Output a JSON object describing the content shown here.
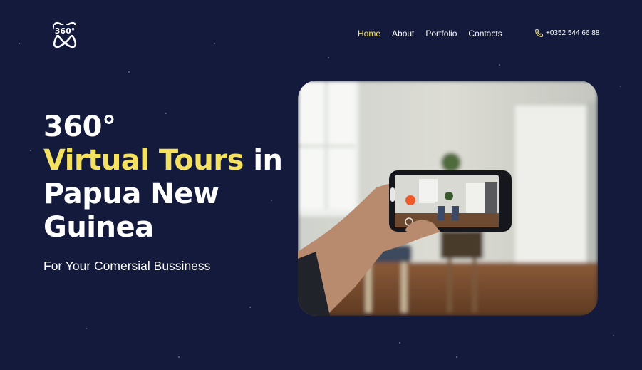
{
  "brand": {
    "logo_text": "360°",
    "logo_icon": "360-orbit-logo-icon"
  },
  "nav": [
    {
      "label": "Home",
      "active": true
    },
    {
      "label": "About",
      "active": false
    },
    {
      "label": "Portfolio",
      "active": false
    },
    {
      "label": "Contacts",
      "active": false
    }
  ],
  "contact": {
    "phone": "+0352 544 66 88",
    "icon": "phone-icon"
  },
  "hero": {
    "title_line1": "360°",
    "title_highlight": "Virtual Tours",
    "title_in": " in",
    "title_line3": "Papua New",
    "title_line4": "Guinea",
    "subtitle": "For Your Comersial Bussiness"
  },
  "media": {
    "description": "hand-holding-phone-photo"
  },
  "colors": {
    "background": "#141a3c",
    "accent": "#f4e15f",
    "record": "#f05a2a"
  }
}
